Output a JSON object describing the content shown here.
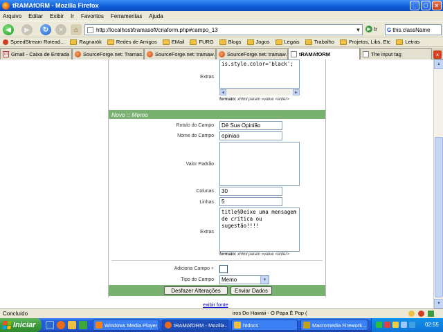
{
  "window": {
    "title": "tRAMAfORM - Mozilla Firefox"
  },
  "menu": [
    "Arquivo",
    "Editar",
    "Exibir",
    "Ir",
    "Favoritos",
    "Ferramentas",
    "Ajuda"
  ],
  "nav": {
    "url": "http://localhost/tramasoft/criaform.php#campo_13",
    "go_label": "Ir",
    "search_value": "this.className"
  },
  "bookmarks": [
    "SpeedStream Rotead...",
    "Ragnarök",
    "Redes de Amigos",
    "EMail",
    "FURG",
    "Blogs",
    "Jogos",
    "Legais",
    "Trabalho",
    "Projetos, Libs, Etc",
    "Letras"
  ],
  "tabs": [
    {
      "label": "Gmail - Caixa de Entrada"
    },
    {
      "label": "SourceForge.net: Tramas..."
    },
    {
      "label": "SourceForge.net: tramaw..."
    },
    {
      "label": "SourceForge.net: tramaw..."
    },
    {
      "label": "tRAMAfORM"
    },
    {
      "label": "The input tag"
    }
  ],
  "form": {
    "prev_extras_label": "Extras",
    "prev_extras_value": "is.style.color='black';",
    "hint_bold": "formato:",
    "hint_italic": " xhtml param =value <enter>",
    "section_title": "Novo :: Memo",
    "rotulo_label": "Rotulo do Campo",
    "rotulo_value": "Dê Sua Opinião",
    "nome_label": "Nome do Campo",
    "nome_value": "opiniao",
    "valor_label": "Valor Padrão",
    "valor_value": "",
    "colunas_label": "Colunas",
    "colunas_value": "30",
    "linhas_label": "Linhas",
    "linhas_value": "5",
    "extras_label": "Extras",
    "extras_value": "title§Deixe uma mensagem de crítica ou sugestão!!!!",
    "adiciona_label": "Adiciona Campo +",
    "tipo_label": "Tipo do Campo",
    "tipo_value": "Memo",
    "btn_desfazer": "Desfazer Alterações",
    "btn_enviar": "Enviar Dados",
    "link_exibir": "exibir fonte"
  },
  "status": {
    "text": "Concluído",
    "music": "iros Do Hawaii - O Papa É Pop ("
  },
  "taskbar": {
    "start": "Iniciar",
    "tasks": [
      "Windows Media Player",
      "tRAMAfORM - Mozilla...",
      "htdocs",
      "Macromedia Firework..."
    ],
    "clock": "02:55"
  },
  "colors": {
    "section_green": "#79b170",
    "link": "#0000cc"
  }
}
